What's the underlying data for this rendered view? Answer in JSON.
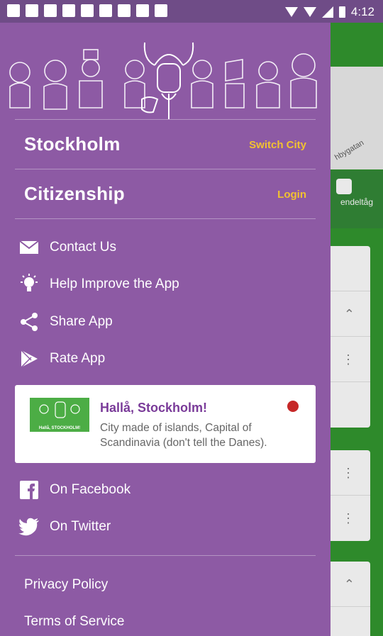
{
  "status_bar": {
    "time": "4:12"
  },
  "background_app": {
    "map_street": "hbygatan",
    "train_label": "endeltåg"
  },
  "drawer": {
    "city": {
      "name": "Stockholm",
      "action": "Switch City"
    },
    "citizenship": {
      "title": "Citizenship",
      "action": "Login"
    },
    "menu": [
      {
        "label": "Contact Us",
        "icon": "envelope-icon"
      },
      {
        "label": "Help Improve the App",
        "icon": "lightbulb-icon"
      },
      {
        "label": "Share App",
        "icon": "share-icon"
      },
      {
        "label": "Rate App",
        "icon": "play-store-icon"
      }
    ],
    "promo": {
      "title": "Hallå, Stockholm!",
      "text": "City made of islands, Capital of Scandinavia (don't tell the Danes).",
      "thumb_caption": "Hallå, STOCKHOLM!"
    },
    "social": [
      {
        "label": "On Facebook",
        "icon": "facebook-icon"
      },
      {
        "label": "On Twitter",
        "icon": "twitter-icon"
      }
    ],
    "footer": {
      "privacy": "Privacy Policy",
      "terms": "Terms of Service"
    }
  },
  "colors": {
    "drawer_bg": "#8d5aa4",
    "accent_yellow": "#f2c230",
    "promo_title": "#7a3b99",
    "app_green": "#2e8a2b"
  }
}
